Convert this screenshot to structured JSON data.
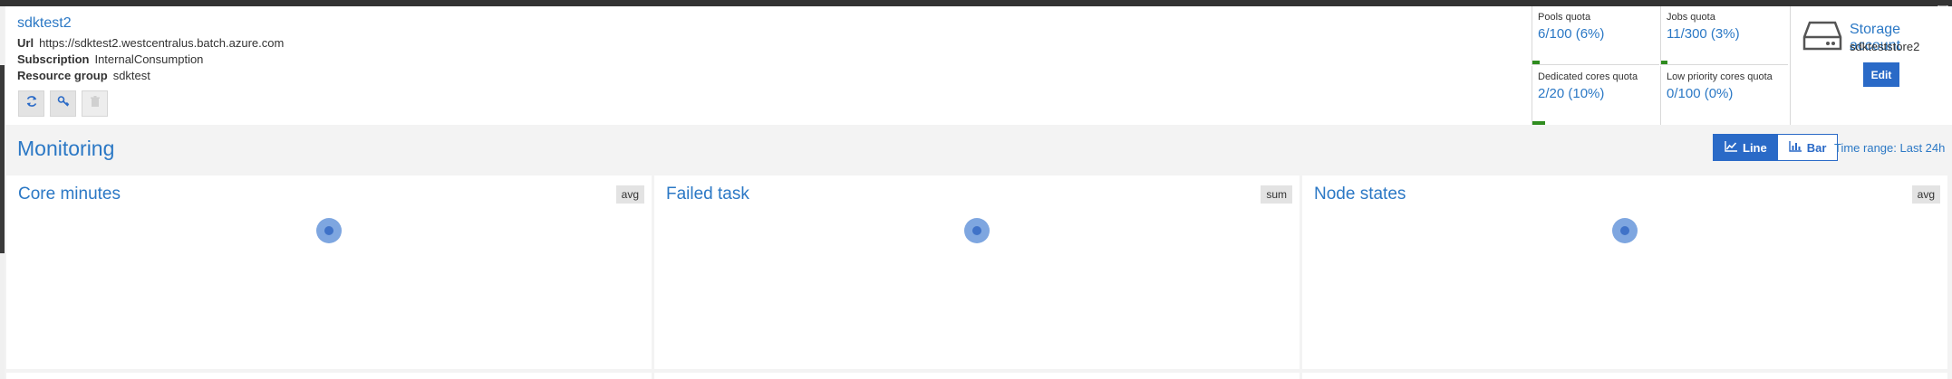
{
  "account": {
    "name": "sdktest2",
    "url_label": "Url",
    "url": "https://sdktest2.westcentralus.batch.azure.com",
    "subscription_label": "Subscription",
    "subscription": "InternalConsumption",
    "resource_group_label": "Resource group",
    "resource_group": "sdktest",
    "actions": [
      {
        "icon": "refresh-icon",
        "enabled": true
      },
      {
        "icon": "key-icon",
        "enabled": true
      },
      {
        "icon": "trash-icon",
        "enabled": false
      }
    ]
  },
  "quotas": [
    {
      "label": "Pools quota",
      "value": "6/100 (6%)",
      "percent": 6
    },
    {
      "label": "Jobs quota",
      "value": "11/300 (3%)",
      "percent": 3
    },
    {
      "label": "Dedicated cores quota",
      "value": "2/20 (10%)",
      "percent": 10
    },
    {
      "label": "Low priority cores quota",
      "value": "0/100 (0%)",
      "percent": 0
    }
  ],
  "storage": {
    "label": "Storage account",
    "name": "sdkteststore2",
    "edit_label": "Edit",
    "icon": "storage-drive-icon"
  },
  "monitoring": {
    "title": "Monitoring",
    "chart_types": [
      {
        "label": "Line",
        "icon": "line-chart-icon",
        "active": true
      },
      {
        "label": "Bar",
        "icon": "bar-chart-icon",
        "active": false
      }
    ],
    "time_range": "Time range: Last 24h",
    "panels": [
      {
        "title": "Core minutes",
        "aggregation": "avg"
      },
      {
        "title": "Failed task",
        "aggregation": "sum"
      },
      {
        "title": "Node states",
        "aggregation": "avg"
      }
    ]
  },
  "colors": {
    "accent": "#2b78c5",
    "button_primary": "#2a6ac7",
    "quota_bar": "#2f8c1f",
    "spinner": "#7ea6e0"
  }
}
